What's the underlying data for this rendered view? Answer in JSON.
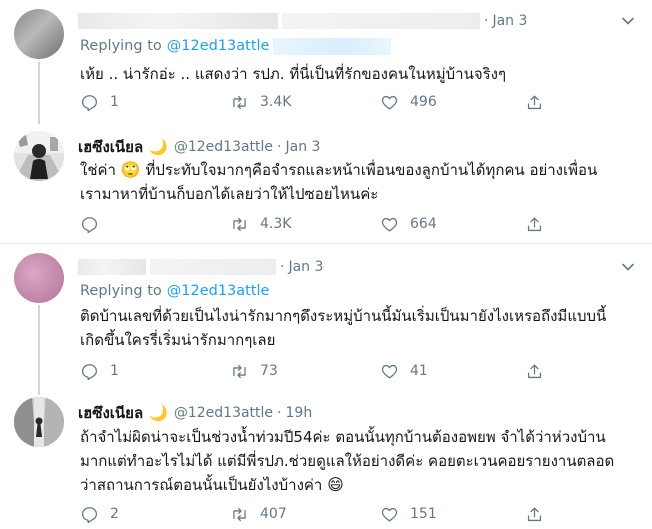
{
  "tweets": [
    {
      "time": "Jan 3",
      "replying_label": "Replying to",
      "replying_handle": "@12ed13attle",
      "text": "เห้ย .. น่ารักอ่ะ .. แสดงว่า รปภ. ที่นี่เป็นที่รักของคนในหมู่บ้านจริงๆ",
      "replies": "1",
      "retweets": "3.4K",
      "likes": "496"
    },
    {
      "name": "เฮซึงเนียล",
      "name_emoji": "🌙",
      "handle": "@12ed13attle",
      "sep": "·",
      "time": "Jan 3",
      "text_1": "ใช่ค่า",
      "text_emoji": "🙄",
      "text_2": " ที่ประทับใจมากๆคือจำรถและหน้าเพื่อนของลูกบ้านได้ทุกคน อย่างเพื่อน\nเรามาหาที่บ้านก็บอกได้เลยว่าให้ไปซอยไหนค่ะ",
      "replies": "",
      "retweets": "4.3K",
      "likes": "664"
    },
    {
      "sep": "·",
      "time": "Jan 3",
      "replying_label": "Replying to",
      "replying_handle": "@12ed13attle",
      "text": "ติดบ้านเลขที่ด้วยเป็นไงน่ารักมากๆดึงระหมู่บ้านนี้มันเริ่มเป็นมายังไงเหรอถึงมีแบบนี้\nเกิดขึ้นใครรี่เริ่มน่ารักมากๆเลย",
      "replies": "1",
      "retweets": "73",
      "likes": "41"
    },
    {
      "name": "เฮซึงเนียล",
      "name_emoji": "🌙",
      "handle": "@12ed13attle",
      "sep": "·",
      "time": "19h",
      "text_1": "ถ้าจำไม่ผิดน่าจะเป็นช่วงน้ำท่วมปี54ค่ะ ตอนนั้นทุกบ้านต้องอพยพ จำได้ว่าห่วงบ้าน\nมากแต่ทำอะไรไม่ได้ แต่มีพี่รปภ.ช่วยดูแลให้อย่างดีค่ะ คอยตะเวนคอยรายงานตลอด\nว่าสถานการณ์ตอนนั้นเป็นยังไงบ้างค่า ",
      "text_emoji": "😄",
      "replies": "2",
      "retweets": "407",
      "likes": "151"
    }
  ],
  "icons": {
    "reply": "reply-icon",
    "retweet": "retweet-icon",
    "like": "heart-icon",
    "share": "share-icon",
    "more": "chevron-down-icon"
  },
  "colors": {
    "link": "#1da1f2",
    "muted": "#657786",
    "thread_line": "#ccd6dd"
  }
}
